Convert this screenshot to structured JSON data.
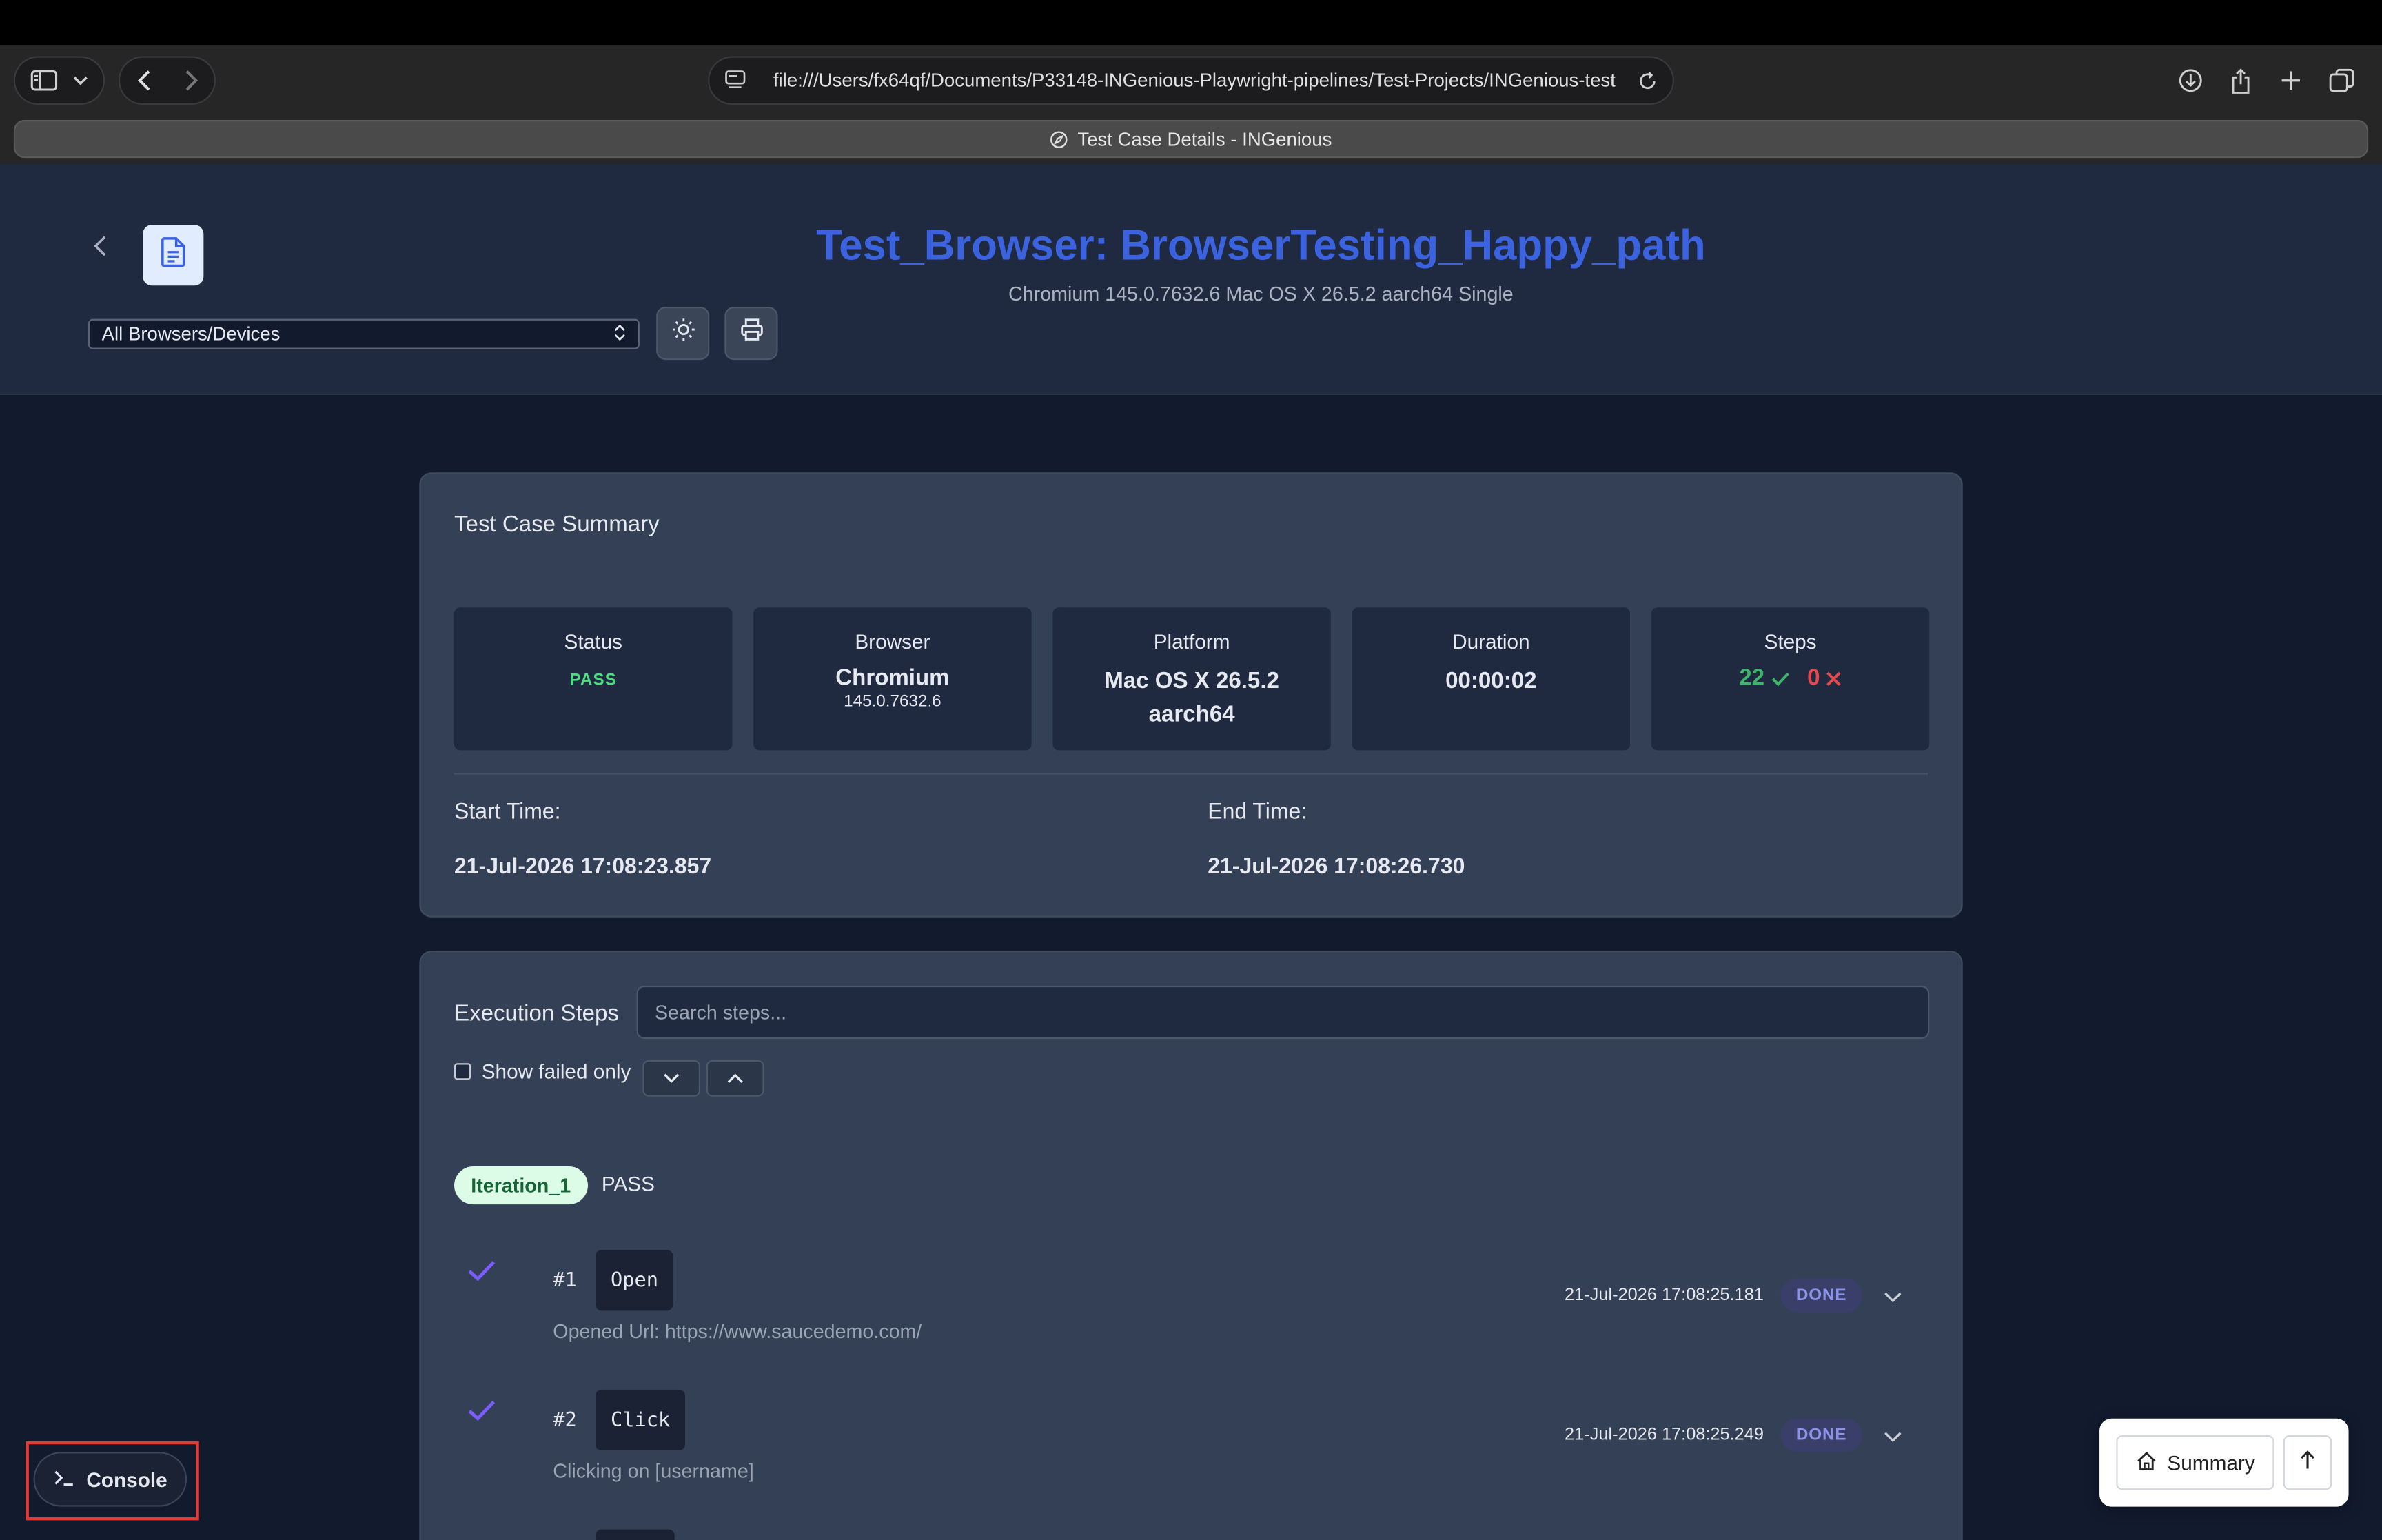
{
  "browser": {
    "url": "file:///Users/fx64qf/Documents/P33148-INGenious-Playwright-pipelines/Test-Projects/INGenious-test",
    "tab_title": "Test Case Details - INGenious"
  },
  "header": {
    "title": "Test_Browser: BrowserTesting_Happy_path",
    "subtitle": "Chromium 145.0.7632.6 Mac OS X 26.5.2 aarch64 Single",
    "browser_select": "All Browsers/Devices"
  },
  "summary": {
    "title": "Test Case Summary",
    "status_label": "Status",
    "status_value": "PASS",
    "browser_label": "Browser",
    "browser_name": "Chromium",
    "browser_version": "145.0.7632.6",
    "platform_label": "Platform",
    "platform_line1": "Mac OS X 26.5.2",
    "platform_line2": "aarch64",
    "duration_label": "Duration",
    "duration_value": "00:00:02",
    "steps_label": "Steps",
    "steps_passed": "22",
    "steps_failed": "0",
    "start_label": "Start Time:",
    "start_value": "21-Jul-2026 17:08:23.857",
    "end_label": "End Time:",
    "end_value": "21-Jul-2026 17:08:26.730"
  },
  "execution": {
    "title": "Execution Steps",
    "search_placeholder": "Search steps...",
    "show_failed_label": "Show failed only",
    "iteration_label": "Iteration_1",
    "iteration_status": "PASS",
    "steps": [
      {
        "num": "#1",
        "command": "Open",
        "description": "Opened Url: https://www.saucedemo.com/",
        "time": "21-Jul-2026 17:08:25.181",
        "status": "DONE"
      },
      {
        "num": "#2",
        "command": "Click",
        "description": "Clicking on [username]",
        "time": "21-Jul-2026 17:08:25.249",
        "status": "DONE"
      }
    ]
  },
  "floating": {
    "console_label": "Console",
    "summary_label": "Summary"
  },
  "colors": {
    "title_blue": "#3b63e0",
    "pass_green": "#4ade80",
    "fail_red": "#e5484d",
    "check_purple": "#7c5cff"
  }
}
